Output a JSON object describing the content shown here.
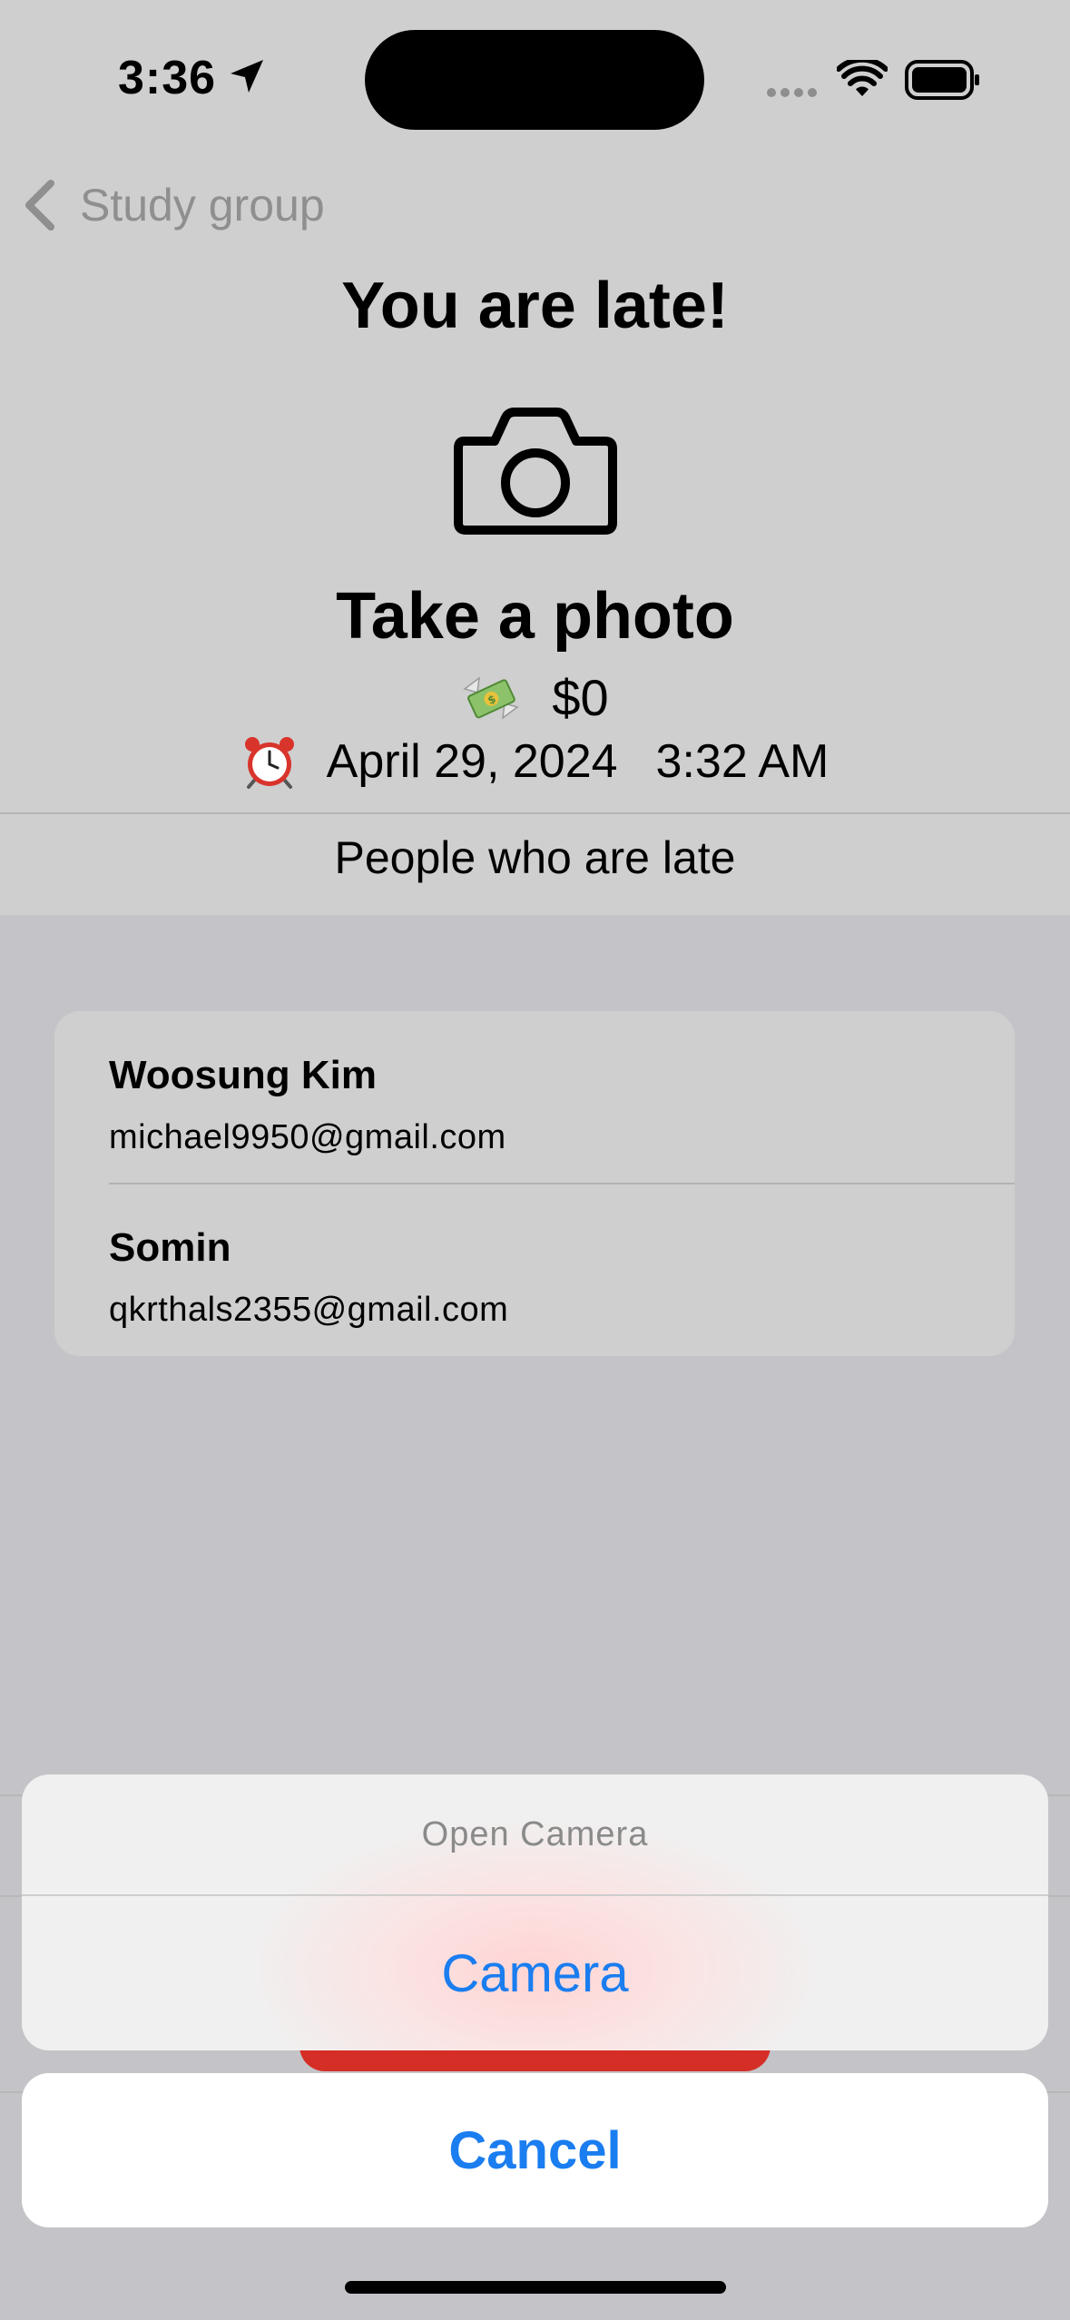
{
  "status_bar": {
    "time": "3:36",
    "icons": [
      "location-arrow-icon",
      "signal-icon",
      "wifi-icon",
      "battery-icon"
    ]
  },
  "nav": {
    "back_label": "Study group",
    "back_icon": "chevron-left-icon"
  },
  "header": {
    "title": "You are late!",
    "camera_icon": "camera-icon",
    "action_label": "Take a photo",
    "fine_icon": "money-with-wings-icon",
    "fine_amount": "$0",
    "alarm_icon": "alarm-clock-icon",
    "date": "April 29, 2024",
    "time": "3:32 AM"
  },
  "late_list": {
    "header": "People who are late",
    "people": [
      {
        "name": "Woosung Kim",
        "email": "michael9950@gmail.com"
      },
      {
        "name": "Somin",
        "email": "qkrthals2355@gmail.com"
      }
    ]
  },
  "action_sheet": {
    "title": "Open Camera",
    "options": [
      "Camera"
    ],
    "cancel_label": "Cancel"
  },
  "colors": {
    "accent_blue": "#1a7df0",
    "destructive_red": "#d52e26",
    "dimmed_background": "#c4c4c8"
  }
}
